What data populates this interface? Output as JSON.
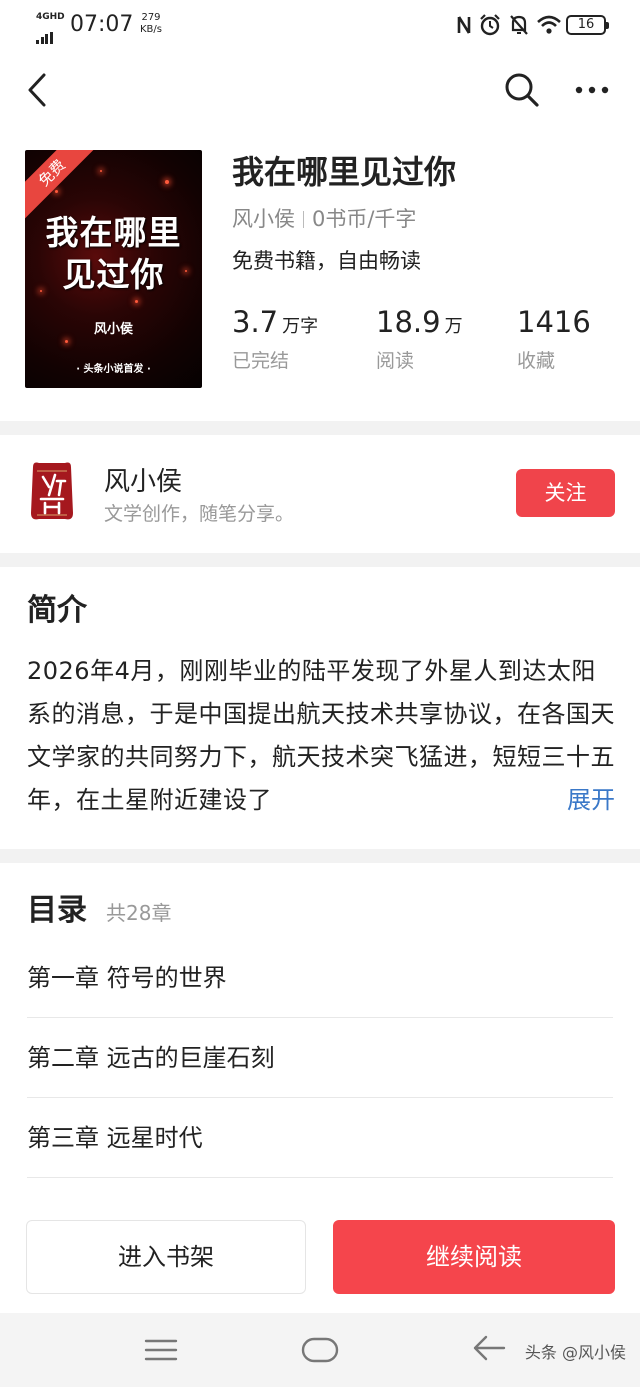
{
  "status_bar": {
    "network": "4GHD",
    "time": "07:07",
    "speed_value": "279",
    "speed_unit": "KB/s",
    "battery": "16"
  },
  "nav": {
    "back_icon": "chevron-left-icon",
    "search_icon": "search-icon",
    "more_icon": "more-horizontal-icon"
  },
  "book": {
    "cover": {
      "ribbon": "免费",
      "title_line1": "我在哪里",
      "title_line2": "见过你",
      "author": "风小侯",
      "tag": "· 头条小说首发 ·"
    },
    "title": "我在哪里见过你",
    "author": "风小侯",
    "price": "0书币/千字",
    "desc": "免费书籍，自由畅读",
    "stats": [
      {
        "num": "3.7",
        "unit": "万字",
        "label": "已完结"
      },
      {
        "num": "18.9",
        "unit": "万",
        "label": "阅读"
      },
      {
        "num": "1416",
        "unit": "",
        "label": "收藏"
      }
    ]
  },
  "author_card": {
    "avatar_text": "侯門",
    "name": "风小侯",
    "bio": "文学创作，随笔分享。",
    "follow_label": "关注"
  },
  "intro": {
    "title": "简介",
    "text": "2026年4月，刚刚毕业的陆平发现了外星人到达太阳系的消息，于是中国提出航天技术共享协议，在各国天文学家的共同努力下，航天技术突飞猛进，短短三十五年，在土星附近建设了",
    "expand_label": "展开"
  },
  "toc": {
    "title": "目录",
    "count": "共28章",
    "chapters": [
      "第一章 符号的世界",
      "第二章 远古的巨崖石刻",
      "第三章 远星时代"
    ]
  },
  "actions": {
    "shelf_label": "进入书架",
    "read_label": "继续阅读"
  },
  "system_nav": {
    "watermark": "头条 @风小侯"
  },
  "colors": {
    "accent_red": "#f0444b",
    "link_blue": "#3a78c8"
  }
}
